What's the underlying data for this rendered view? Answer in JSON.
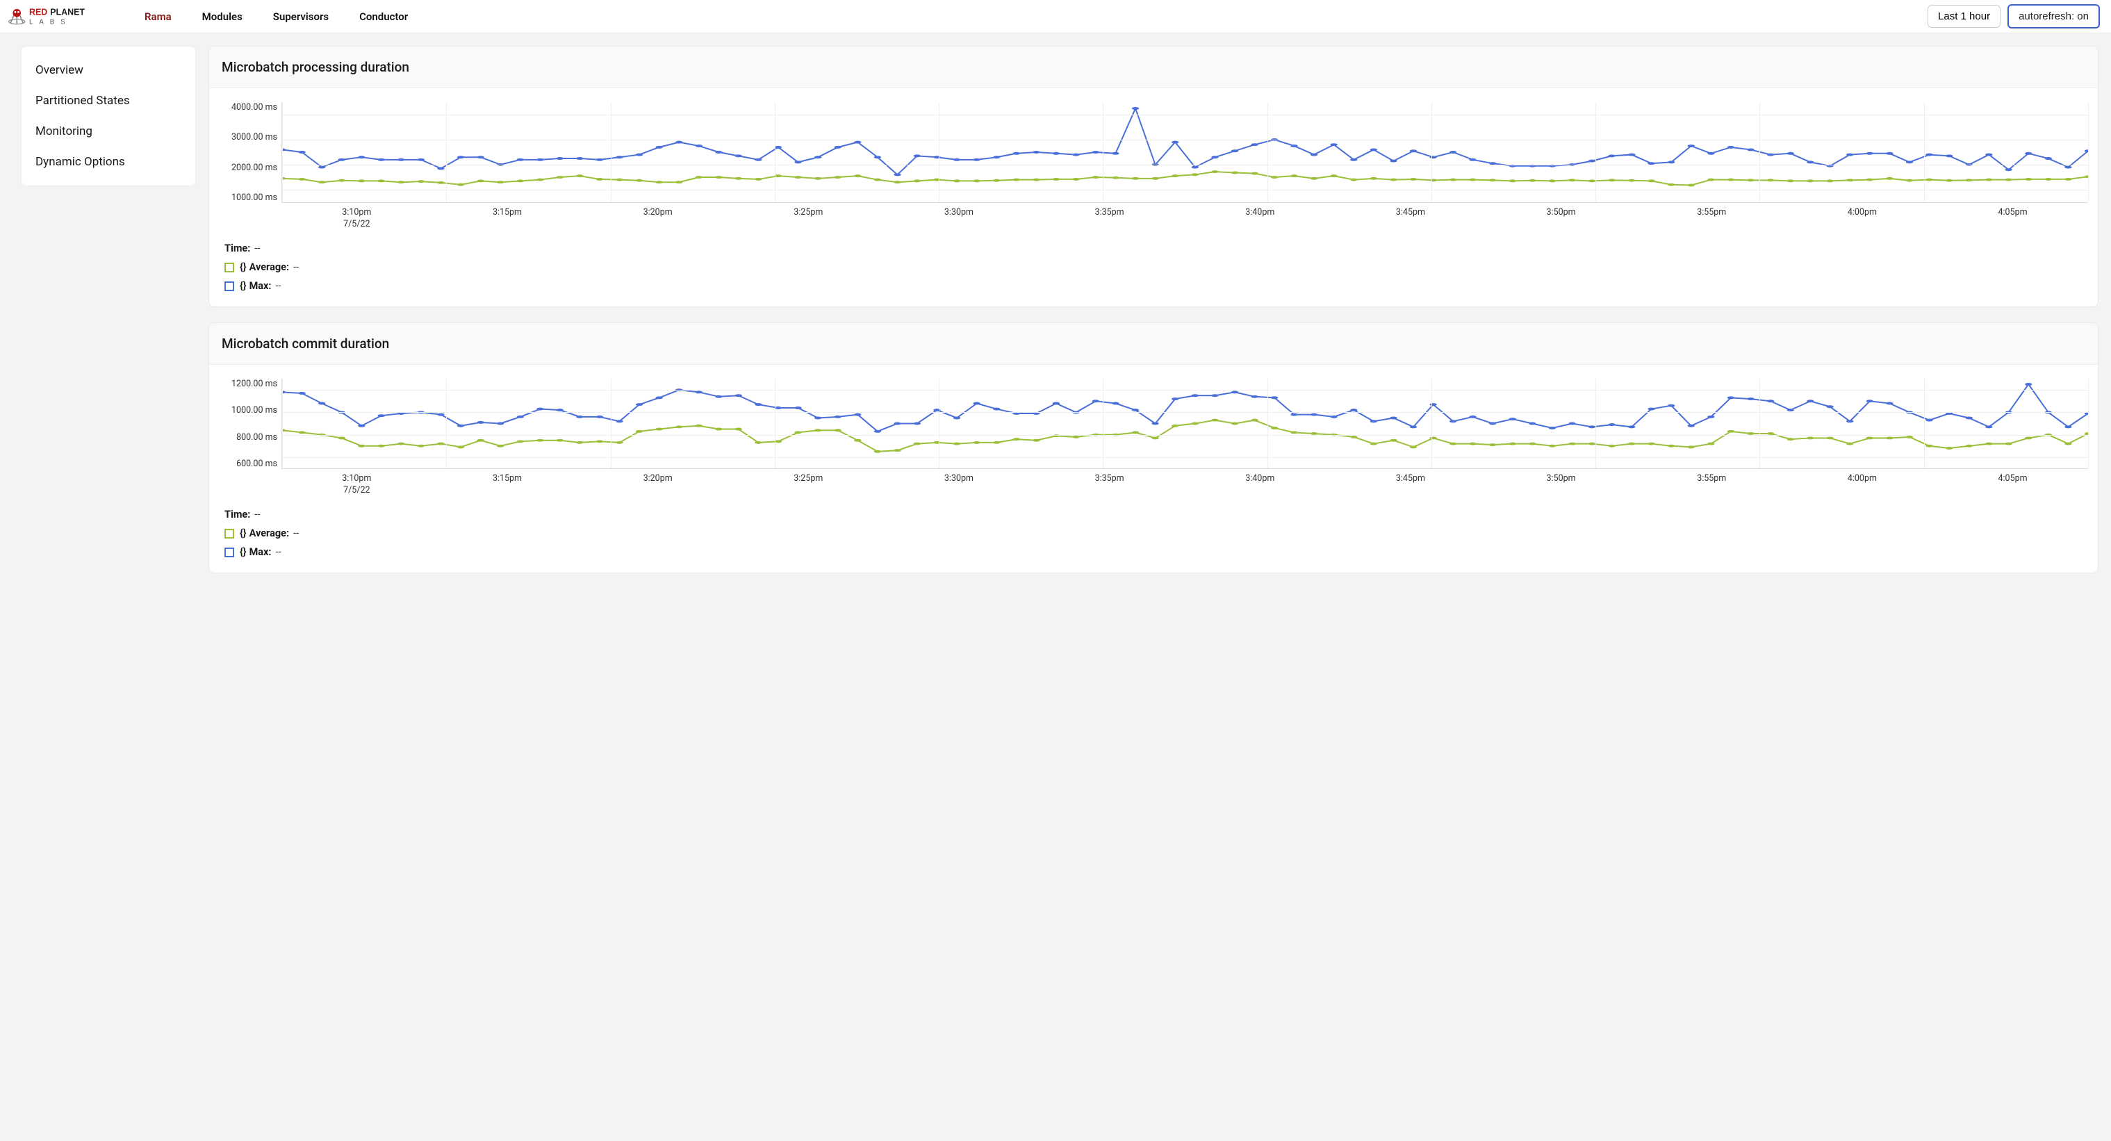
{
  "header": {
    "nav": [
      {
        "label": "Rama",
        "active": true
      },
      {
        "label": "Modules",
        "active": false
      },
      {
        "label": "Supervisors",
        "active": false
      },
      {
        "label": "Conductor",
        "active": false
      }
    ],
    "timerange_label": "Last 1 hour",
    "autorefresh_label": "autorefresh: on"
  },
  "sidebar": {
    "items": [
      {
        "label": "Overview"
      },
      {
        "label": "Partitioned States"
      },
      {
        "label": "Monitoring"
      },
      {
        "label": "Dynamic Options"
      }
    ]
  },
  "legend_common": {
    "time_label": "Time:",
    "time_value": "--",
    "avg_braces": "{}",
    "avg_label": "Average:",
    "avg_value": "--",
    "max_braces": "{}",
    "max_label": "Max:",
    "max_value": "--"
  },
  "chart_data": [
    {
      "id": "processing",
      "title": "Microbatch processing duration",
      "type": "line",
      "x_categories": [
        "3:10pm",
        "3:15pm",
        "3:20pm",
        "3:25pm",
        "3:30pm",
        "3:35pm",
        "3:40pm",
        "3:45pm",
        "3:50pm",
        "3:55pm",
        "4:00pm",
        "4:05pm"
      ],
      "x_subdate": [
        "7/5/22",
        "",
        "",
        "",
        "",
        "",
        "",
        "",
        "",
        "",
        "",
        ""
      ],
      "y_ticks": [
        "4000.00 ms",
        "3000.00 ms",
        "2000.00 ms",
        "1000.00 ms"
      ],
      "ylim": [
        500,
        4500
      ],
      "xlabel": "",
      "ylabel": "",
      "height": 145,
      "series": [
        {
          "name": "Max",
          "color": "blue",
          "values": [
            2600,
            2500,
            1900,
            2200,
            2300,
            2200,
            2200,
            2200,
            1850,
            2300,
            2300,
            2000,
            2200,
            2200,
            2250,
            2250,
            2200,
            2300,
            2400,
            2700,
            2900,
            2750,
            2500,
            2350,
            2200,
            2700,
            2100,
            2300,
            2700,
            2900,
            2300,
            1600,
            2350,
            2300,
            2200,
            2200,
            2300,
            2450,
            2500,
            2450,
            2400,
            2500,
            2450,
            4250,
            2000,
            2900,
            1900,
            2300,
            2550,
            2800,
            3000,
            2750,
            2400,
            2800,
            2200,
            2600,
            2150,
            2550,
            2300,
            2500,
            2200,
            2050,
            1950,
            1950,
            1950,
            2000,
            2150,
            2350,
            2400,
            2050,
            2100,
            2750,
            2450,
            2700,
            2600,
            2400,
            2450,
            2100,
            1950,
            2400,
            2450,
            2450,
            2100,
            2400,
            2350,
            2000,
            2400,
            1800,
            2450,
            2250,
            1900,
            2550
          ]
        },
        {
          "name": "Average",
          "color": "green",
          "values": [
            1450,
            1420,
            1300,
            1370,
            1350,
            1350,
            1300,
            1330,
            1280,
            1200,
            1350,
            1300,
            1350,
            1400,
            1500,
            1550,
            1420,
            1400,
            1370,
            1300,
            1300,
            1500,
            1500,
            1450,
            1420,
            1550,
            1500,
            1450,
            1500,
            1550,
            1400,
            1300,
            1350,
            1400,
            1350,
            1350,
            1370,
            1400,
            1400,
            1420,
            1420,
            1500,
            1480,
            1450,
            1450,
            1550,
            1600,
            1720,
            1680,
            1650,
            1500,
            1550,
            1450,
            1550,
            1400,
            1450,
            1400,
            1420,
            1380,
            1400,
            1400,
            1380,
            1350,
            1370,
            1350,
            1380,
            1350,
            1380,
            1370,
            1350,
            1200,
            1180,
            1400,
            1400,
            1380,
            1380,
            1350,
            1350,
            1350,
            1380,
            1400,
            1450,
            1370,
            1400,
            1370,
            1380,
            1400,
            1400,
            1420,
            1420,
            1420,
            1520
          ]
        }
      ]
    },
    {
      "id": "commit",
      "title": "Microbatch commit duration",
      "type": "line",
      "x_categories": [
        "3:10pm",
        "3:15pm",
        "3:20pm",
        "3:25pm",
        "3:30pm",
        "3:35pm",
        "3:40pm",
        "3:45pm",
        "3:50pm",
        "3:55pm",
        "4:00pm",
        "4:05pm"
      ],
      "x_subdate": [
        "7/5/22",
        "",
        "",
        "",
        "",
        "",
        "",
        "",
        "",
        "",
        "",
        ""
      ],
      "y_ticks": [
        "1200.00 ms",
        "1000.00 ms",
        "800.00 ms",
        "600.00 ms"
      ],
      "ylim": [
        500,
        1300
      ],
      "xlabel": "",
      "ylabel": "",
      "height": 130,
      "series": [
        {
          "name": "Max",
          "color": "blue",
          "values": [
            1180,
            1170,
            1080,
            1000,
            880,
            970,
            990,
            1000,
            980,
            880,
            910,
            900,
            960,
            1030,
            1020,
            960,
            960,
            920,
            1070,
            1130,
            1200,
            1180,
            1140,
            1150,
            1070,
            1040,
            1040,
            950,
            960,
            980,
            830,
            900,
            900,
            1020,
            950,
            1080,
            1030,
            990,
            990,
            1080,
            1000,
            1100,
            1080,
            1020,
            900,
            1120,
            1150,
            1150,
            1180,
            1140,
            1130,
            980,
            980,
            960,
            1020,
            920,
            950,
            870,
            1070,
            920,
            960,
            900,
            940,
            900,
            860,
            900,
            870,
            890,
            870,
            1030,
            1060,
            880,
            960,
            1130,
            1120,
            1100,
            1020,
            1100,
            1050,
            920,
            1100,
            1080,
            1000,
            930,
            990,
            950,
            870,
            1000,
            1250,
            1000,
            870,
            990
          ]
        },
        {
          "name": "Average",
          "color": "green",
          "values": [
            840,
            820,
            800,
            770,
            700,
            700,
            720,
            700,
            720,
            690,
            750,
            700,
            740,
            750,
            750,
            730,
            740,
            730,
            830,
            850,
            870,
            880,
            850,
            850,
            730,
            740,
            820,
            840,
            840,
            750,
            650,
            660,
            720,
            730,
            720,
            730,
            730,
            760,
            750,
            790,
            780,
            800,
            800,
            820,
            770,
            880,
            900,
            930,
            900,
            930,
            860,
            820,
            810,
            800,
            780,
            720,
            750,
            690,
            770,
            720,
            720,
            710,
            720,
            720,
            700,
            720,
            720,
            700,
            720,
            720,
            700,
            690,
            720,
            830,
            810,
            810,
            760,
            770,
            770,
            720,
            770,
            770,
            780,
            700,
            680,
            700,
            720,
            720,
            770,
            800,
            720,
            810
          ]
        }
      ]
    }
  ]
}
